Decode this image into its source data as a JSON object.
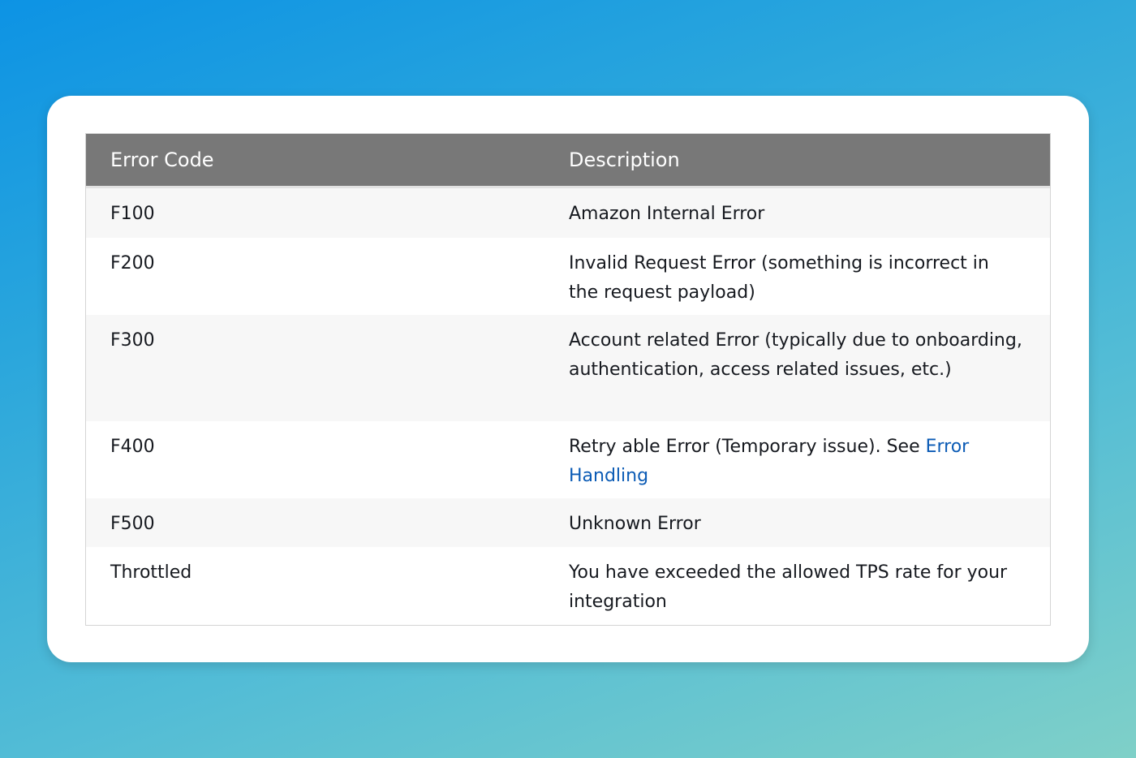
{
  "table": {
    "headers": {
      "code": "Error Code",
      "description": "Description"
    },
    "rows": [
      {
        "code": "F100",
        "description": "Amazon Internal Error"
      },
      {
        "code": "F200",
        "description": "Invalid Request Error (something is incorrect in the request payload)"
      },
      {
        "code": "F300",
        "description": "Account related Error (typically due to onboarding, authentication, access related issues, etc.)"
      },
      {
        "code": "F400",
        "description": "Retry able Error (Temporary issue). See ",
        "link_text": "Error Handling"
      },
      {
        "code": "F500",
        "description": "Unknown Error"
      },
      {
        "code": "Throttled",
        "description": "You have exceeded the allowed TPS rate for your integration"
      }
    ]
  },
  "colors": {
    "header_bg": "#787878",
    "link": "#0b5bb5",
    "row_alt": "#f7f7f7"
  }
}
